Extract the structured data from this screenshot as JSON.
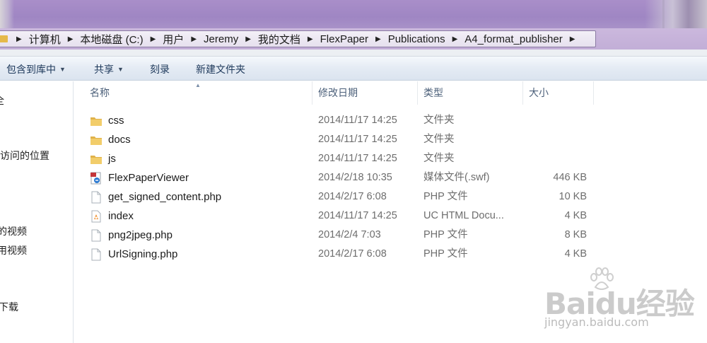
{
  "breadcrumbs": [
    "计算机",
    "本地磁盘 (C:)",
    "用户",
    "Jeremy",
    "我的文档",
    "FlexPaper",
    "Publications",
    "A4_format_publisher"
  ],
  "toolbar": {
    "include_library": "包含到库中",
    "share": "共享",
    "burn": "刻录",
    "new_folder": "新建文件夹"
  },
  "nav": {
    "items": [
      "全",
      "访问的位置",
      "的视频",
      "用视频",
      "下载"
    ]
  },
  "columns": {
    "name": "名称",
    "modified": "修改日期",
    "type": "类型",
    "size": "大小"
  },
  "files": [
    {
      "name": "css",
      "modified": "2014/11/17 14:25",
      "type": "文件夹",
      "size": "",
      "icon": "folder-icon"
    },
    {
      "name": "docs",
      "modified": "2014/11/17 14:25",
      "type": "文件夹",
      "size": "",
      "icon": "folder-icon"
    },
    {
      "name": "js",
      "modified": "2014/11/17 14:25",
      "type": "文件夹",
      "size": "",
      "icon": "folder-icon"
    },
    {
      "name": "FlexPaperViewer",
      "modified": "2014/2/18 10:35",
      "type": "媒体文件(.swf)",
      "size": "446 KB",
      "icon": "swf-file-icon"
    },
    {
      "name": "get_signed_content.php",
      "modified": "2014/2/17 6:08",
      "type": "PHP 文件",
      "size": "10 KB",
      "icon": "blank-file-icon"
    },
    {
      "name": "index",
      "modified": "2014/11/17 14:25",
      "type": "UC HTML Docu...",
      "size": "4 KB",
      "icon": "html-file-icon"
    },
    {
      "name": "png2jpeg.php",
      "modified": "2014/2/4 7:03",
      "type": "PHP 文件",
      "size": "8 KB",
      "icon": "blank-file-icon"
    },
    {
      "name": "UrlSigning.php",
      "modified": "2014/2/17 6:08",
      "type": "PHP 文件",
      "size": "4 KB",
      "icon": "blank-file-icon"
    }
  ],
  "watermark": {
    "logo": "Baidu经验",
    "url": "jingyan.baidu.com"
  },
  "colors": {
    "title_glass": "#a98ec9",
    "folder": "#e5b94a",
    "toolbar_text": "#1e395b",
    "header_text": "#4c607a"
  }
}
